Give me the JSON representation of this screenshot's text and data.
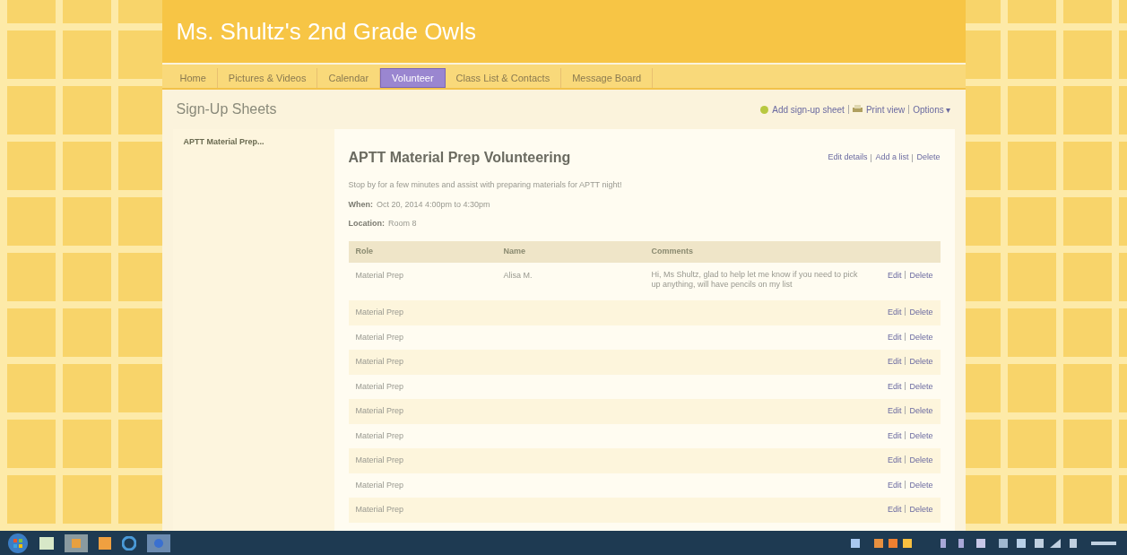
{
  "site_title": "Ms. Shultz's 2nd Grade Owls",
  "nav": [
    {
      "label": "Home",
      "selected": false
    },
    {
      "label": "Pictures & Videos",
      "selected": false
    },
    {
      "label": "Calendar",
      "selected": false
    },
    {
      "label": "Volunteer",
      "selected": true
    },
    {
      "label": "Class List & Contacts",
      "selected": false
    },
    {
      "label": "Message Board",
      "selected": false
    }
  ],
  "section_title": "Sign-Up Sheets",
  "section_actions": [
    {
      "kind": "add",
      "label": "Add sign-up sheet"
    },
    {
      "kind": "print",
      "label": "Print view"
    },
    {
      "kind": "menu",
      "label": "Options ▾"
    }
  ],
  "sidebar": {
    "items": [
      {
        "label": "APTT Material Prep...",
        "selected": true
      }
    ]
  },
  "sheet": {
    "title": "APTT Material Prep Volunteering",
    "actions": [
      "Edit details",
      "Add a list",
      "Delete"
    ],
    "description": "Stop by for a few minutes and assist with preparing materials for APTT night!",
    "fields": [
      {
        "label": "When:",
        "value": "Oct 20, 2014 4:00pm to 4:30pm"
      },
      {
        "label": "Location:",
        "value": "Room 8"
      }
    ]
  },
  "table": {
    "columns": [
      "Role",
      "Name",
      "Comments"
    ],
    "rows": [
      {
        "role": "Material Prep",
        "name": "Alisa M.",
        "comments": "Hi, Ms Shultz, glad to help let me know if you need to pick up anything, will have pencils on my list",
        "actions": [
          "Edit",
          "Delete"
        ]
      },
      {
        "role": "Material Prep",
        "actions": [
          "Edit",
          "Delete"
        ]
      },
      {
        "role": "Material Prep",
        "actions": [
          "Edit",
          "Delete"
        ]
      },
      {
        "role": "Material Prep",
        "actions": [
          "Edit",
          "Delete"
        ]
      },
      {
        "role": "Material Prep",
        "actions": [
          "Edit",
          "Delete"
        ]
      },
      {
        "role": "Material Prep",
        "actions": [
          "Edit",
          "Delete"
        ]
      },
      {
        "role": "Material Prep",
        "actions": [
          "Edit",
          "Delete"
        ]
      },
      {
        "role": "Material Prep",
        "actions": [
          "Edit",
          "Delete"
        ]
      },
      {
        "role": "Material Prep",
        "actions": [
          "Edit",
          "Delete"
        ]
      },
      {
        "role": "Material Prep",
        "actions": [
          "Edit",
          "Delete"
        ]
      }
    ]
  }
}
